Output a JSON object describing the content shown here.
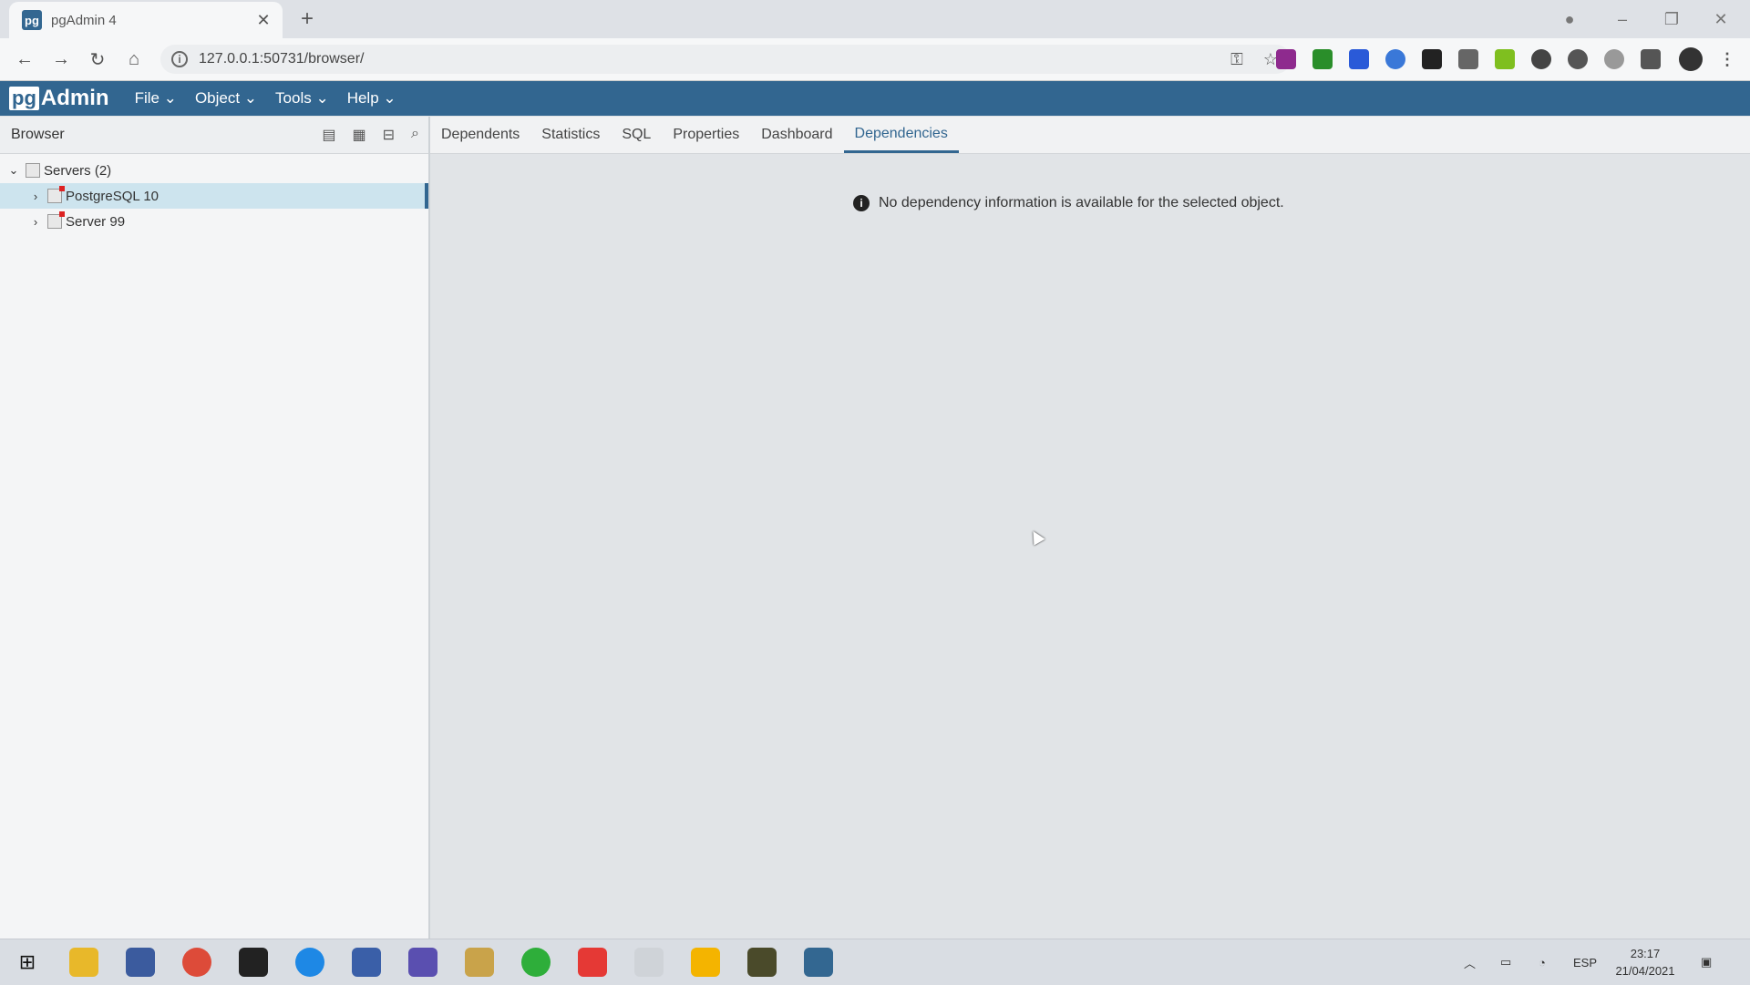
{
  "browser": {
    "tab_title": "pgAdmin 4",
    "favicon_text": "pg",
    "url": "127.0.0.1:50731/browser/"
  },
  "pgadmin": {
    "logo_pg": "pg",
    "logo_admin": "Admin",
    "menu": [
      "File ⌄",
      "Object ⌄",
      "Tools ⌄",
      "Help ⌄"
    ]
  },
  "left_panel": {
    "title": "Browser",
    "tree": {
      "root": "Servers (2)",
      "children": [
        "PostgreSQL 10",
        "Server 99"
      ]
    }
  },
  "right_panel": {
    "tabs": [
      "Dependents",
      "Statistics",
      "SQL",
      "Properties",
      "Dashboard",
      "Dependencies"
    ],
    "active_tab": "Dependencies",
    "message": "No dependency information is available for the selected object."
  },
  "taskbar": {
    "language": "ESP",
    "time": "23:17",
    "date": "21/04/2021"
  },
  "colors": {
    "pg_blue": "#326690",
    "selected_row": "#cde4ee"
  }
}
